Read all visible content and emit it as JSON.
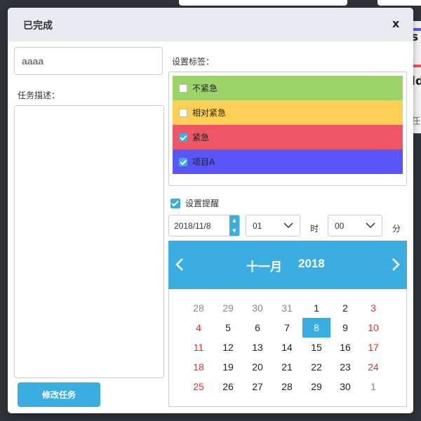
{
  "background": {
    "fragment_1": "s",
    "fragment_2": "ld",
    "fragment_3": "任"
  },
  "modal": {
    "title": "已完成",
    "close_label": "x",
    "task_name_value": "aaaa",
    "description_label": "任务描述：",
    "description_value": "",
    "submit_label": "修改任务"
  },
  "tags": {
    "label": "设置标签：",
    "items": [
      {
        "label": "不紧急",
        "checked": false,
        "color": "#9dd46a"
      },
      {
        "label": "相对紧急",
        "checked": false,
        "color": "#fdd055"
      },
      {
        "label": "紧急",
        "checked": true,
        "color": "#ef5665"
      },
      {
        "label": "项目A",
        "checked": true,
        "color": "#5a55f8"
      }
    ]
  },
  "reminder": {
    "label": "设置提醒",
    "checked": true,
    "date": "2018/11/8",
    "hour": "01",
    "hour_unit": "时",
    "minute": "00",
    "minute_unit": "分"
  },
  "calendar": {
    "month": "十一月",
    "year": "2018",
    "accent": "#3aaee0",
    "weekend_color": "#e53030",
    "weeks": [
      [
        {
          "d": "28",
          "t": "other"
        },
        {
          "d": "29",
          "t": "other"
        },
        {
          "d": "30",
          "t": "other"
        },
        {
          "d": "31",
          "t": "other"
        },
        {
          "d": "1",
          "t": "normal"
        },
        {
          "d": "2",
          "t": "normal"
        },
        {
          "d": "3",
          "t": "weekend"
        }
      ],
      [
        {
          "d": "4",
          "t": "weekend"
        },
        {
          "d": "5",
          "t": "normal"
        },
        {
          "d": "6",
          "t": "normal"
        },
        {
          "d": "7",
          "t": "normal"
        },
        {
          "d": "8",
          "t": "selected"
        },
        {
          "d": "9",
          "t": "normal"
        },
        {
          "d": "10",
          "t": "weekend"
        }
      ],
      [
        {
          "d": "11",
          "t": "weekend"
        },
        {
          "d": "12",
          "t": "normal"
        },
        {
          "d": "13",
          "t": "normal"
        },
        {
          "d": "14",
          "t": "normal"
        },
        {
          "d": "15",
          "t": "normal"
        },
        {
          "d": "16",
          "t": "normal"
        },
        {
          "d": "17",
          "t": "weekend"
        }
      ],
      [
        {
          "d": "18",
          "t": "weekend"
        },
        {
          "d": "19",
          "t": "normal"
        },
        {
          "d": "20",
          "t": "normal"
        },
        {
          "d": "21",
          "t": "normal"
        },
        {
          "d": "22",
          "t": "normal"
        },
        {
          "d": "23",
          "t": "normal"
        },
        {
          "d": "24",
          "t": "weekend"
        }
      ],
      [
        {
          "d": "25",
          "t": "weekend"
        },
        {
          "d": "26",
          "t": "normal"
        },
        {
          "d": "27",
          "t": "normal"
        },
        {
          "d": "28",
          "t": "normal"
        },
        {
          "d": "29",
          "t": "normal"
        },
        {
          "d": "30",
          "t": "normal"
        },
        {
          "d": "1",
          "t": "other"
        }
      ]
    ]
  }
}
